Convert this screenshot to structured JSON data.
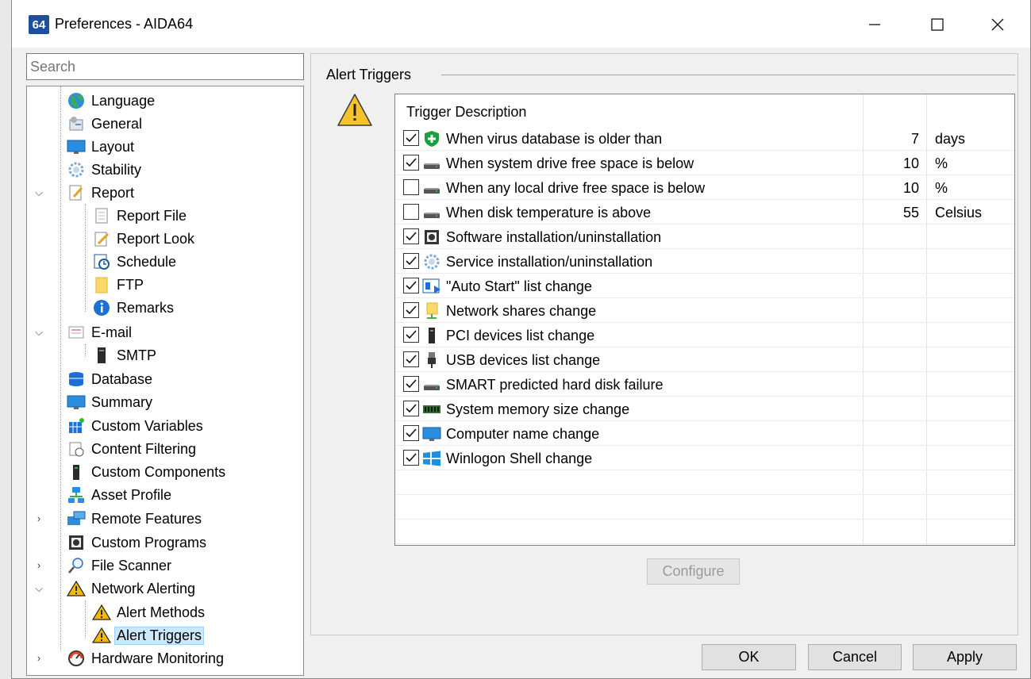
{
  "window": {
    "title": "Preferences - AIDA64",
    "app_icon_text": "64",
    "minimize": "—",
    "maximize": "☐",
    "close": "✕"
  },
  "search": {
    "placeholder": "Search"
  },
  "tree": [
    {
      "label": "Language",
      "icon": "globe-icon"
    },
    {
      "label": "General",
      "icon": "general-settings-icon"
    },
    {
      "label": "Layout",
      "icon": "monitor-icon"
    },
    {
      "label": "Stability",
      "icon": "gear-icon"
    },
    {
      "label": "Report",
      "icon": "report-icon",
      "expanded": true
    },
    {
      "label": "Report File",
      "icon": "document-icon"
    },
    {
      "label": "Report Look",
      "icon": "pencil-document-icon"
    },
    {
      "label": "Schedule",
      "icon": "schedule-icon"
    },
    {
      "label": "FTP",
      "icon": "folder-icon"
    },
    {
      "label": "Remarks",
      "icon": "info-icon"
    },
    {
      "label": "E-mail",
      "icon": "email-icon",
      "expanded": true
    },
    {
      "label": "SMTP",
      "icon": "server-icon"
    },
    {
      "label": "Database",
      "icon": "database-icon"
    },
    {
      "label": "Summary",
      "icon": "monitor-icon"
    },
    {
      "label": "Custom Variables",
      "icon": "variables-icon"
    },
    {
      "label": "Content Filtering",
      "icon": "filter-icon"
    },
    {
      "label": "Custom Components",
      "icon": "tower-icon"
    },
    {
      "label": "Asset Profile",
      "icon": "network-icon"
    },
    {
      "label": "Remote Features",
      "icon": "remote-icon",
      "collapsed": true
    },
    {
      "label": "Custom Programs",
      "icon": "programs-icon"
    },
    {
      "label": "File Scanner",
      "icon": "magnifier-icon",
      "collapsed": true
    },
    {
      "label": "Network Alerting",
      "icon": "warning-icon",
      "expanded": true
    },
    {
      "label": "Alert Methods",
      "icon": "warning-icon"
    },
    {
      "label": "Alert Triggers",
      "icon": "warning-icon",
      "selected": true
    },
    {
      "label": "Hardware Monitoring",
      "icon": "gauge-icon",
      "collapsed": true
    }
  ],
  "group": {
    "title": "Alert Triggers"
  },
  "list": {
    "header": "Trigger Description",
    "rows": [
      {
        "checked": true,
        "icon": "shield-icon",
        "description": "When virus database is older than",
        "value": "7",
        "unit": "days"
      },
      {
        "checked": true,
        "icon": "drive-icon",
        "description": "When system drive free space is below",
        "value": "10",
        "unit": "%"
      },
      {
        "checked": false,
        "icon": "drive-icon",
        "description": "When any local drive free space is below",
        "value": "10",
        "unit": "%"
      },
      {
        "checked": false,
        "icon": "drive-icon",
        "description": "When disk temperature is above",
        "value": "55",
        "unit": "Celsius"
      },
      {
        "checked": true,
        "icon": "software-icon",
        "description": "Software installation/uninstallation",
        "value": "",
        "unit": ""
      },
      {
        "checked": true,
        "icon": "gear-icon",
        "description": "Service installation/uninstallation",
        "value": "",
        "unit": ""
      },
      {
        "checked": true,
        "icon": "autostart-icon",
        "description": "\"Auto Start\" list change",
        "value": "",
        "unit": ""
      },
      {
        "checked": true,
        "icon": "share-icon",
        "description": "Network shares change",
        "value": "",
        "unit": ""
      },
      {
        "checked": true,
        "icon": "pci-icon",
        "description": "PCI devices list change",
        "value": "",
        "unit": ""
      },
      {
        "checked": true,
        "icon": "usb-icon",
        "description": "USB devices list change",
        "value": "",
        "unit": ""
      },
      {
        "checked": true,
        "icon": "drive-icon",
        "description": "SMART predicted hard disk failure",
        "value": "",
        "unit": ""
      },
      {
        "checked": true,
        "icon": "memory-icon",
        "description": "System memory size change",
        "value": "",
        "unit": ""
      },
      {
        "checked": true,
        "icon": "monitor-icon",
        "description": "Computer name change",
        "value": "",
        "unit": ""
      },
      {
        "checked": true,
        "icon": "windows-icon",
        "description": "Winlogon Shell change",
        "value": "",
        "unit": ""
      }
    ]
  },
  "buttons": {
    "configure": "Configure",
    "ok": "OK",
    "cancel": "Cancel",
    "apply": "Apply"
  },
  "colors": {
    "selection": "#cce8ff",
    "warning": "#f5b800",
    "accent": "#1d4f9c"
  }
}
